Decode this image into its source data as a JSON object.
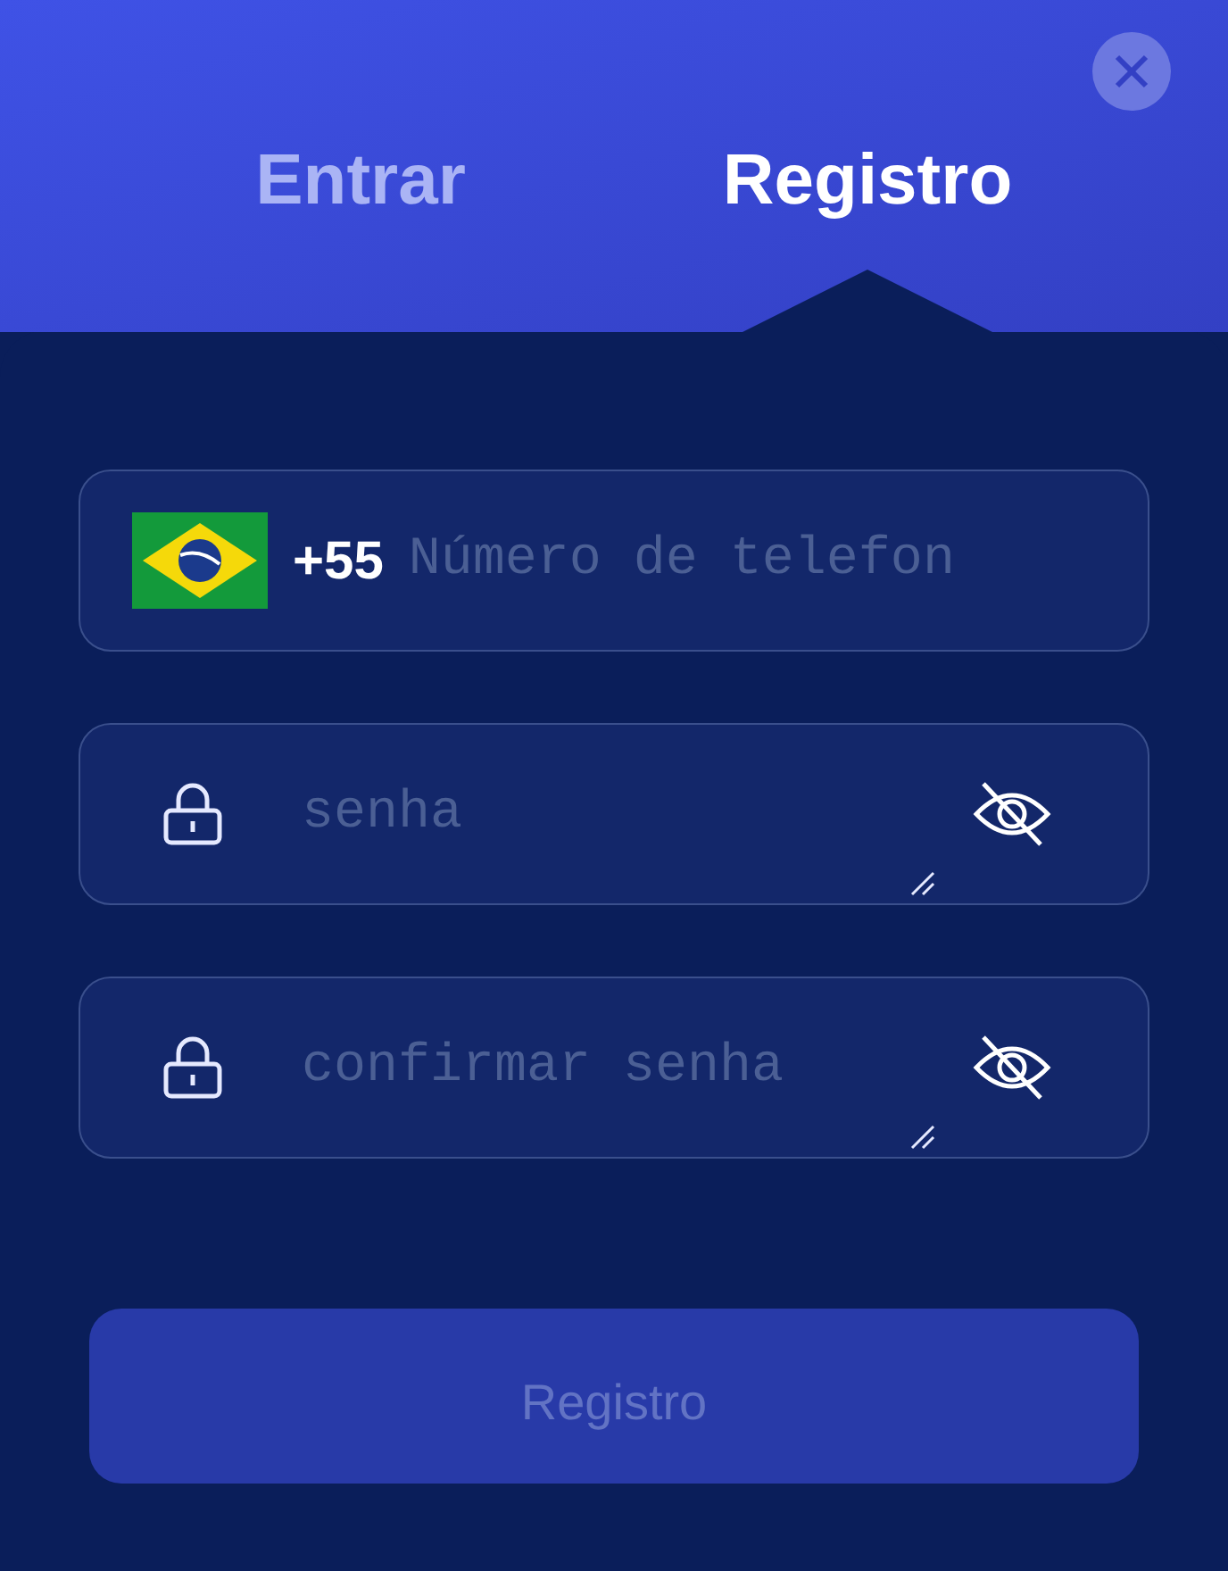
{
  "tabs": [
    {
      "label": "Entrar",
      "selected": false
    },
    {
      "label": "Registro",
      "selected": true
    }
  ],
  "fields": [
    {
      "kind": "phone",
      "prefix": "+55",
      "placeholder": "Número de telefon"
    },
    {
      "kind": "password",
      "placeholder": "senha"
    },
    {
      "kind": "password",
      "placeholder": "confirmar senha"
    }
  ],
  "submit": {
    "label": "Registro",
    "disabled": true
  }
}
